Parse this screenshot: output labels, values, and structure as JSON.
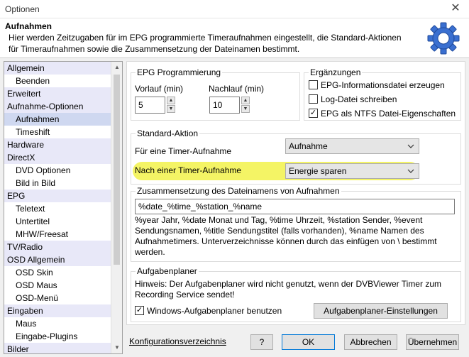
{
  "window": {
    "title": "Optionen",
    "close_glyph": "✕"
  },
  "header": {
    "title": "Aufnahmen",
    "description": "Hier werden Zeitzugaben für im EPG programmierte Timeraufnahmen eingestellt, die Standard-Aktionen für Timeraufnahmen sowie die Zusammensetzung der Dateinamen bestimmt.",
    "icon": "gear-icon"
  },
  "sidebar": {
    "items": [
      {
        "label": "Allgemein",
        "kind": "cat"
      },
      {
        "label": "Beenden",
        "kind": "sub"
      },
      {
        "label": "Erweitert",
        "kind": "cat"
      },
      {
        "label": "Aufnahme-Optionen",
        "kind": "cat"
      },
      {
        "label": "Aufnahmen",
        "kind": "sub",
        "selected": true
      },
      {
        "label": "Timeshift",
        "kind": "sub"
      },
      {
        "label": "Hardware",
        "kind": "cat"
      },
      {
        "label": "DirectX",
        "kind": "cat"
      },
      {
        "label": "DVD Optionen",
        "kind": "sub"
      },
      {
        "label": "Bild in Bild",
        "kind": "sub"
      },
      {
        "label": "EPG",
        "kind": "cat"
      },
      {
        "label": "Teletext",
        "kind": "sub"
      },
      {
        "label": "Untertitel",
        "kind": "sub"
      },
      {
        "label": "MHW/Freesat",
        "kind": "sub"
      },
      {
        "label": "TV/Radio",
        "kind": "cat"
      },
      {
        "label": "OSD Allgemein",
        "kind": "cat"
      },
      {
        "label": "OSD Skin",
        "kind": "sub"
      },
      {
        "label": "OSD Maus",
        "kind": "sub"
      },
      {
        "label": "OSD-Menü",
        "kind": "sub"
      },
      {
        "label": "Eingaben",
        "kind": "cat"
      },
      {
        "label": "Maus",
        "kind": "sub"
      },
      {
        "label": "Eingabe-Plugins",
        "kind": "sub"
      },
      {
        "label": "Bilder",
        "kind": "cat"
      }
    ]
  },
  "epg": {
    "group_label": "EPG Programmierung",
    "vorlauf_label": "Vorlauf (min)",
    "vorlauf_value": "5",
    "nachlauf_label": "Nachlauf (min)",
    "nachlauf_value": "10"
  },
  "ergaenzungen": {
    "group_label": "Ergänzungen",
    "options": [
      {
        "label": "EPG-Informationsdatei erzeugen",
        "checked": false
      },
      {
        "label": "Log-Datei schreiben",
        "checked": false
      },
      {
        "label": "EPG als NTFS Datei-Eigenschaften",
        "checked": true
      }
    ]
  },
  "standard_aktion": {
    "group_label": "Standard-Aktion",
    "timer_label": "Für eine Timer-Aufnahme",
    "timer_value": "Aufnahme",
    "nach_label": "Nach einer Timer-Aufnahme",
    "nach_value": "Energie sparen"
  },
  "dateinamen": {
    "group_label": "Zusammensetzung des Dateinamens von Aufnahmen",
    "pattern": "%date_%time_%station_%name",
    "help": "%year Jahr, %date Monat und Tag, %time Uhrzeit, %station Sender, %event Sendungsnamen, %title Sendungstitel (falls vorhanden), %name Namen des Aufnahmetimers. Unterverzeichnisse können durch das einfügen von \\ bestimmt werden."
  },
  "aufgabenplaner": {
    "group_label": "Aufgabenplaner",
    "hint": "Hinweis: Der Aufgabenplaner wird nicht genutzt, wenn der DVBViewer Timer zum Recording Service sendet!",
    "use_label": "Windows-Aufgabenplaner benutzen",
    "use_checked": true,
    "settings_button": "Aufgabenplaner-Einstellungen"
  },
  "footer": {
    "config_link": "Konfigurationsverzeichnis",
    "help_button": "?",
    "ok_button": "OK",
    "cancel_button": "Abbrechen",
    "apply_button": "Übernehmen"
  }
}
